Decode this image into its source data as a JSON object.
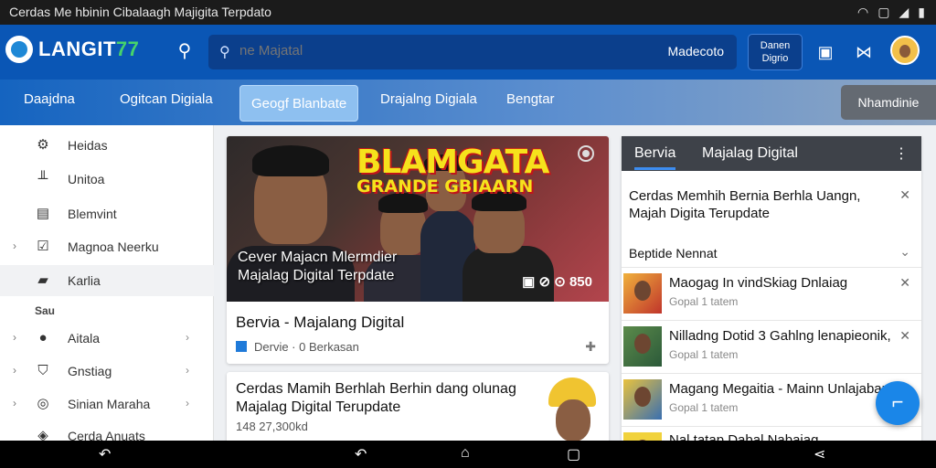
{
  "statusbar": {
    "title": "Cerdas Me hbinin Cibalaagh Majigita Terpdato",
    "icons": [
      "wifi-icon",
      "square-icon",
      "signal-icon",
      "battery-icon"
    ]
  },
  "appbar": {
    "logo_text": "LANGIT",
    "logo_num": "77",
    "search_placeholder": "ne Majatal",
    "search_right": "Madecoto",
    "login_label_line1": "Danen",
    "login_label_line2": "Digrio",
    "accent": "#0a56b5"
  },
  "tabs": [
    {
      "label": "Daajdna"
    },
    {
      "label": "Ogitcan Digiala"
    },
    {
      "label": "Geogf Blanbate"
    },
    {
      "label": "Drajalng Digiala"
    },
    {
      "label": "Bengtar"
    }
  ],
  "tab_right": "Nhamdinie",
  "sidebar": {
    "items": [
      {
        "label": "Heidas",
        "icon": "gear-icon",
        "chev": false,
        "rchev": false
      },
      {
        "label": "Unitoa",
        "icon": "chart-icon",
        "chev": false,
        "rchev": false
      },
      {
        "label": "Blemvint",
        "icon": "window-icon",
        "chev": false,
        "rchev": false
      },
      {
        "label": "Magnoa Neerku",
        "icon": "checkbox-icon",
        "chev": true,
        "rchev": false
      },
      {
        "label": "Karlia",
        "icon": "folder-icon",
        "chev": false,
        "rchev": false
      }
    ],
    "section_header": "Sau",
    "items2": [
      {
        "label": "Aitala",
        "icon": "circle-icon"
      },
      {
        "label": "Gnstiag",
        "icon": "shield-icon"
      },
      {
        "label": "Sinian Maraha",
        "icon": "camera-icon"
      },
      {
        "label": "Cerda Anuats",
        "icon": "gamepad-icon"
      }
    ]
  },
  "card1": {
    "banner_line1": "BLAMGATA",
    "banner_line2": "GRANDE GBIAARN",
    "hero_caption_line1": "Cever Majacn Mlermdier",
    "hero_caption_line2": "Majalag Digital Terpdate",
    "hero_info": "▣ ⊘ ⊙ 850",
    "title": "Bervia - Majalang Digital",
    "meta": "Dervie · 0 Berkasan"
  },
  "card2": {
    "title": "Cerdas Mamih Berhlah Berhin dang olunag Majalag Digital Terupdate",
    "meta": "148 27,300kd"
  },
  "rpanel": {
    "tab1": "Bervia",
    "tab2": "Majalag Digital",
    "notice": "Cerdas Memhih Bernia Berhla Uangn, Majah Digita Terupdate",
    "sub_header": "Beptide Nennat",
    "items": [
      {
        "title": "Maogag In vindSkiag Dnlaiag",
        "meta": "Gopal 1 tatem"
      },
      {
        "title": "Nilladng Dotid 3 Gahlng lenapieonik,",
        "meta": "Gopal 1 tatem"
      },
      {
        "title": "Magang Megaitia - Mainn Unlajabam",
        "meta": "Gopal 1 tatem"
      }
    ],
    "last_item_partial": "Nal tatap Dabal Nabaiag"
  },
  "fab_label": "⌐",
  "navbar": [
    "back-icon",
    "undo-icon",
    "home-icon",
    "recents-icon",
    "share-icon"
  ]
}
